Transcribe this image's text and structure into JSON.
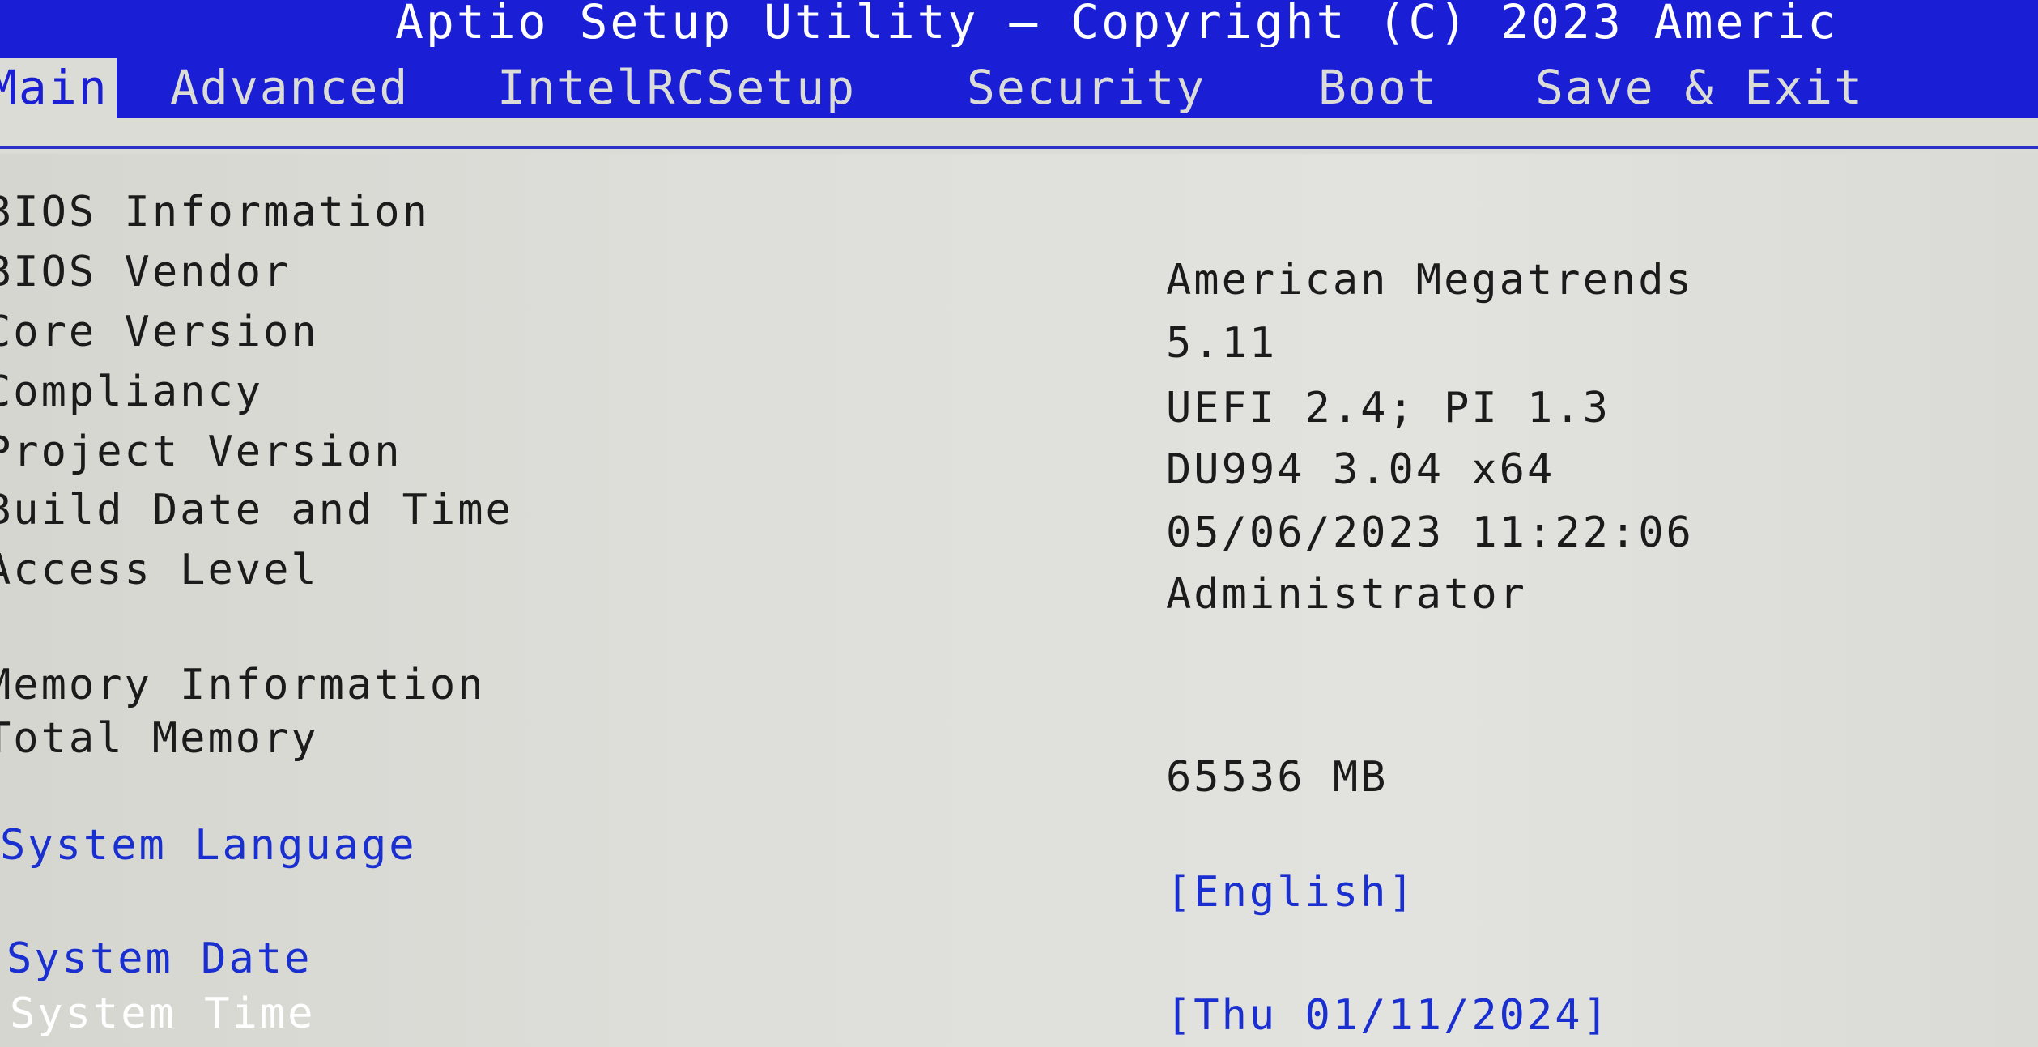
{
  "title": "Aptio Setup Utility – Copyright (C) 2023 Americ",
  "tabs": [
    {
      "label": "Main"
    },
    {
      "label": "Advanced"
    },
    {
      "label": "IntelRCSetup"
    },
    {
      "label": "Security"
    },
    {
      "label": "Boot"
    },
    {
      "label": "Save & Exit"
    }
  ],
  "bios": {
    "section": "BIOS Information",
    "vendor_label": "BIOS Vendor",
    "vendor_value": "American Megatrends",
    "core_label": "Core Version",
    "core_value": "5.11",
    "compliancy_label": "Compliancy",
    "compliancy_value": "UEFI 2.4; PI 1.3",
    "project_label": "Project Version",
    "project_value": "DU994 3.04 x64",
    "build_label": "Build Date and Time",
    "build_value": "05/06/2023 11:22:06",
    "access_label": "Access Level",
    "access_value": "Administrator"
  },
  "memory": {
    "section": "Memory Information",
    "total_label": "Total Memory",
    "total_value": "65536 MB"
  },
  "system": {
    "language_label": "System Language",
    "language_value": "[English]",
    "date_label": "System Date",
    "date_value": "[Thu 01/11/2024]",
    "time_label": "System Time"
  },
  "colors": {
    "bar_blue": "#1a1fd6",
    "background": "#dcdcd6",
    "link_blue": "#1a2fd0"
  }
}
